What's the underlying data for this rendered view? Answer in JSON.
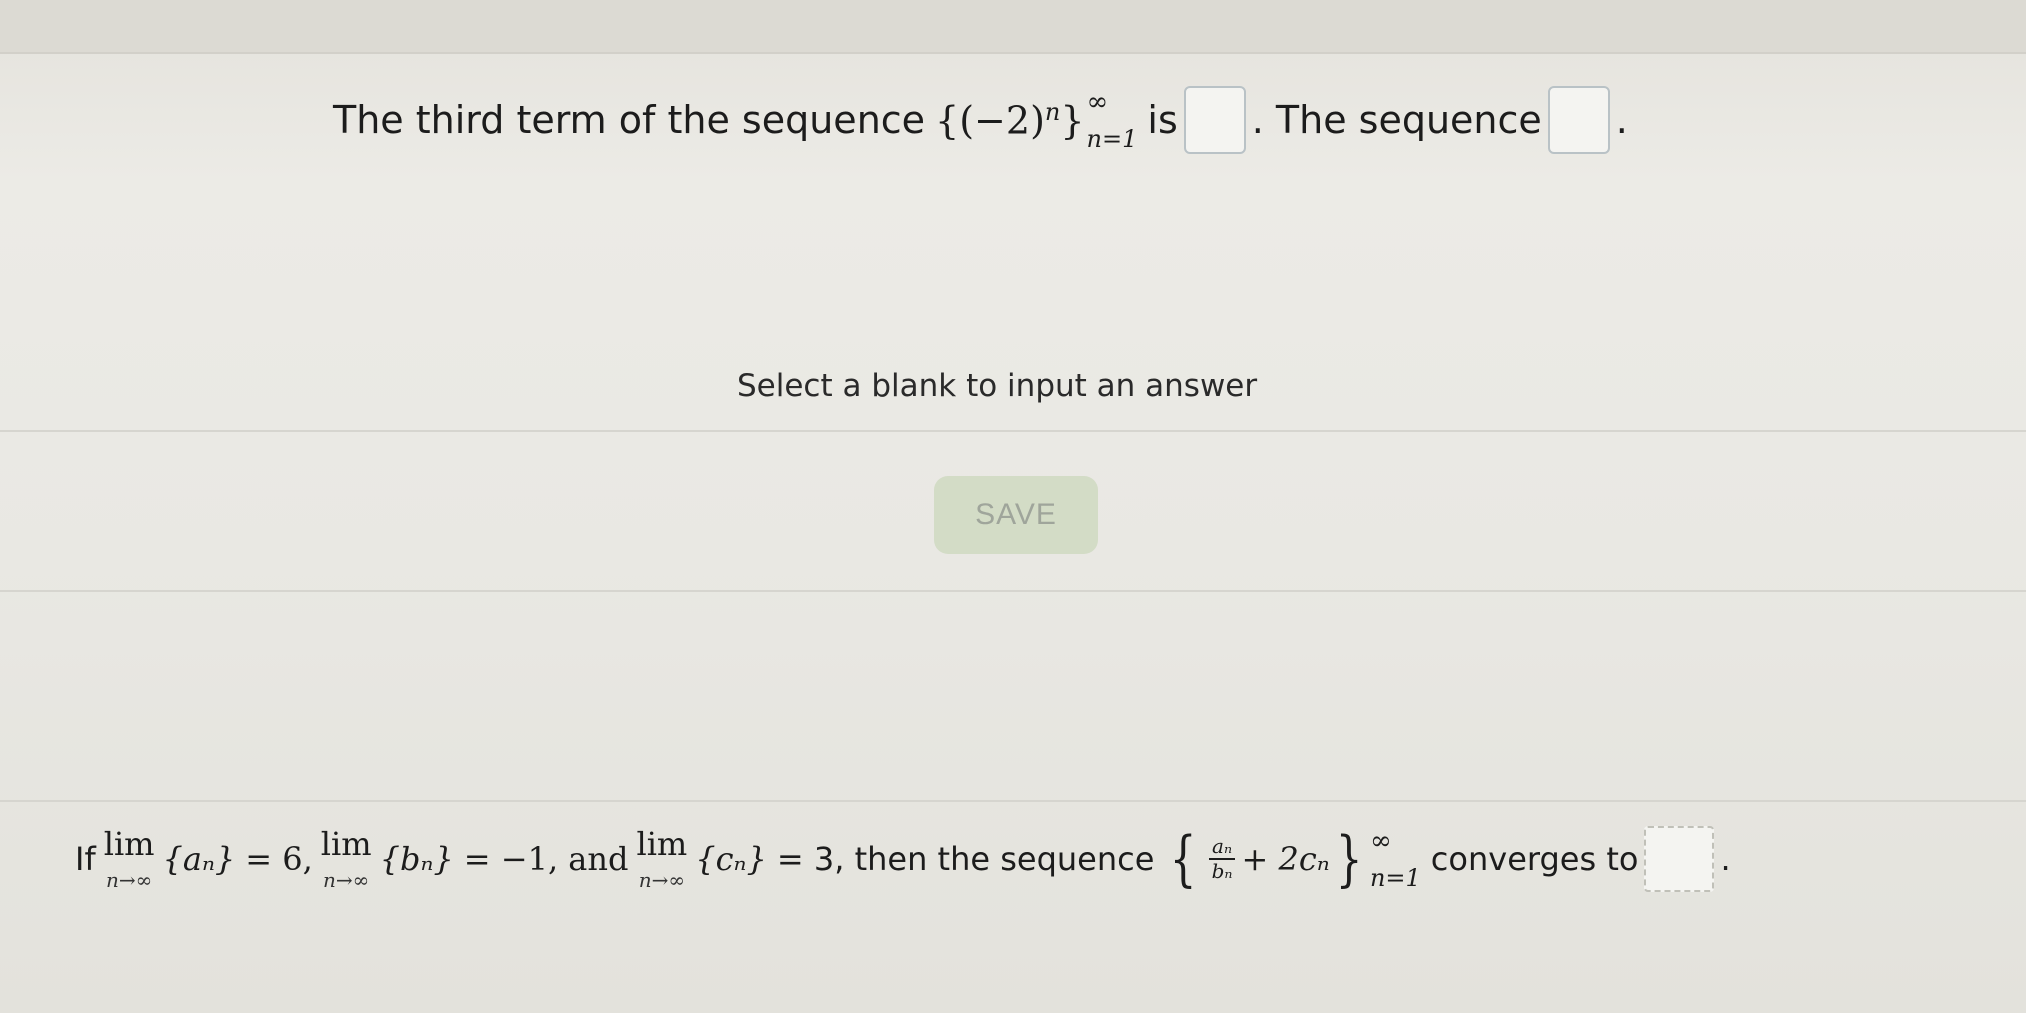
{
  "question1": {
    "text_before": "The third term of the sequence",
    "seq_open": "{(−2)",
    "seq_exp": "n",
    "seq_close": "}",
    "seq_sup": "∞",
    "seq_sub": "n=1",
    "text_is": "is",
    "text_after": ". The sequence",
    "text_end": "."
  },
  "instruction": "Select a blank to input an answer",
  "save_label": "SAVE",
  "question2": {
    "text_if": "If",
    "lim_word": "lim",
    "lim_under": "n→∞",
    "a_seq": "{aₙ}",
    "a_val": "= 6,",
    "b_seq": "{bₙ}",
    "b_val": "= −1, and",
    "c_seq": "{cₙ}",
    "c_val": "= 3, then the sequence",
    "frac_num": "aₙ",
    "frac_den": "bₙ",
    "plus_term": "+ 2cₙ",
    "sup": "∞",
    "sub": "n=1",
    "text_end": "converges to",
    "period": "."
  }
}
